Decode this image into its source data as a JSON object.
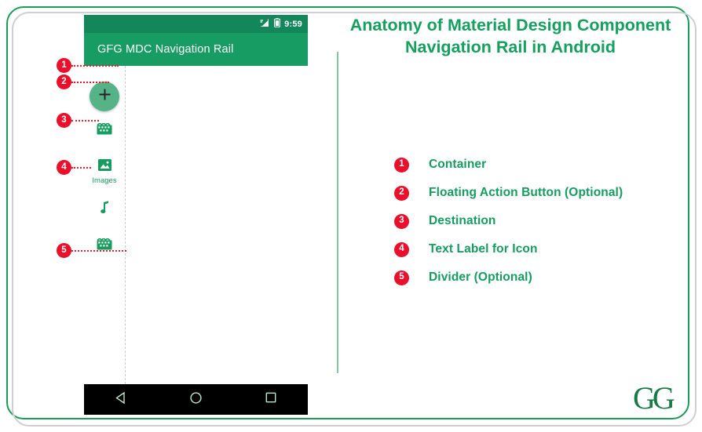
{
  "title": {
    "line1": "Anatomy of Material Design Component",
    "line2": "Navigation Rail in Android"
  },
  "phone": {
    "status_bar": {
      "time": "9:59",
      "signal_icon": "signal-icon",
      "battery_icon": "battery-icon"
    },
    "app_bar": {
      "title": "GFG MDC Navigation Rail"
    },
    "nav_rail": {
      "fab": {
        "icon": "plus-icon",
        "label": ""
      },
      "items": [
        {
          "icon": "movie-icon",
          "label": ""
        },
        {
          "icon": "image-icon",
          "label": "Images"
        },
        {
          "icon": "music-note-icon",
          "label": ""
        },
        {
          "icon": "movie-icon",
          "label": ""
        }
      ]
    },
    "system_nav": {
      "back": "back-triangle-icon",
      "home": "home-circle-icon",
      "recents": "recents-square-icon"
    }
  },
  "markers": [
    {
      "number": "1"
    },
    {
      "number": "2"
    },
    {
      "number": "3"
    },
    {
      "number": "4"
    },
    {
      "number": "5"
    }
  ],
  "legend": [
    {
      "number": "1",
      "label": "Container"
    },
    {
      "number": "2",
      "label": "Floating Action Button (Optional)"
    },
    {
      "number": "3",
      "label": "Destination"
    },
    {
      "number": "4",
      "label": "Text Label for Icon"
    },
    {
      "number": "5",
      "label": "Divider (Optional)"
    }
  ],
  "branding": {
    "logo_text": "GG"
  },
  "colors": {
    "brand_green": "#169c5f",
    "app_bar_green": "#179c63",
    "status_bar_green": "#13875a",
    "marker_red": "#ea0f2b",
    "fab_green": "#56b287",
    "frame_green": "#1a9c5b",
    "frame_gray": "#cfcfcf"
  }
}
